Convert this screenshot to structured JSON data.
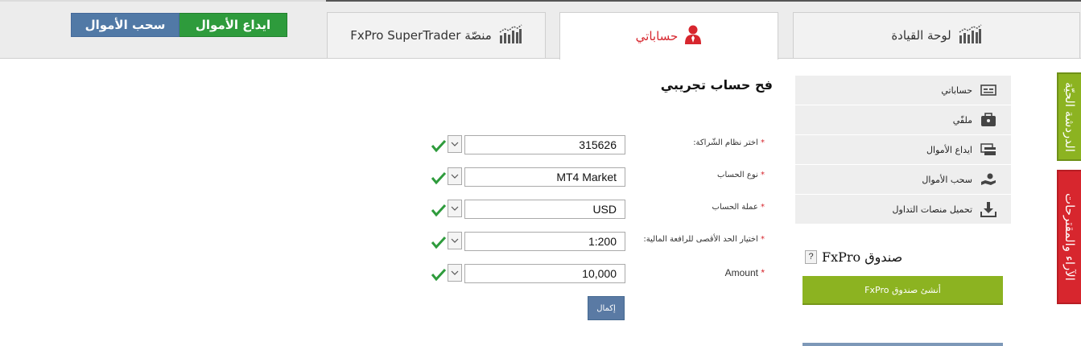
{
  "nav": {
    "tabs": [
      {
        "label": "لوحة القيادة",
        "icon": "bar-chart-icon",
        "active": false
      },
      {
        "label": "حساباتي",
        "icon": "user-icon",
        "active": true
      },
      {
        "label": "منصّة FxPro SuperTrader",
        "icon": "bar-chart-icon",
        "active": false
      }
    ],
    "deposit_label": "ايداع الأموال",
    "withdraw_label": "سحب الأموال"
  },
  "form": {
    "title": "فح حساب تجريبي",
    "fields": [
      {
        "label": "اختر نظام الشّراكة:",
        "value": "315626"
      },
      {
        "label": "نوع الحساب",
        "value": "MT4 Market"
      },
      {
        "label": "عملة الحساب",
        "value": "USD"
      },
      {
        "label": "اختيار الحد الأقصى للرافعة المالية:",
        "value": "1:200"
      },
      {
        "label": "Amount",
        "value": "10,000"
      }
    ],
    "required_mark": "*",
    "submit_label": "إكمال"
  },
  "sidebar": {
    "items": [
      {
        "label": "حساباتي",
        "icon": "id-card-icon"
      },
      {
        "label": "ملفّي",
        "icon": "briefcase-icon"
      },
      {
        "label": "ايداع الأموال",
        "icon": "credit-card-icon"
      },
      {
        "label": "سحب الأموال",
        "icon": "hand-money-icon"
      },
      {
        "label": "تحميل منصات التداول",
        "icon": "download-icon"
      }
    ],
    "fund_title": "صندوق FxPro",
    "help_mark": "?",
    "fund_button": "أنشئ صندوق FxPro"
  },
  "side_tabs": {
    "chat": "الدردشة الحيّة",
    "feedback": "الآراء والمقترحات"
  },
  "colors": {
    "accent_red": "#d7262e",
    "green": "#2e9b3c",
    "lime": "#8cb321",
    "blue": "#5179a6"
  }
}
